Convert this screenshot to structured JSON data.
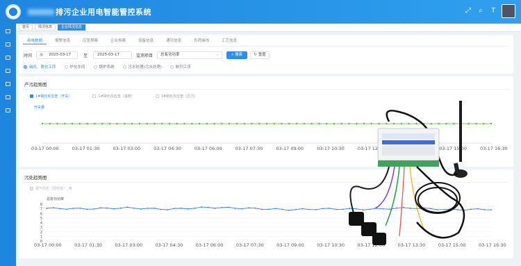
{
  "app": {
    "title": "排污企业用电智能管控系统"
  },
  "page_tabs": [
    {
      "label": "首页"
    },
    {
      "label": "情况信息"
    },
    {
      "label": "企业情况信息"
    }
  ],
  "subtabs": [
    {
      "label": "用电数据"
    },
    {
      "label": "报警信息"
    },
    {
      "label": "应急预案"
    },
    {
      "label": "企业档案"
    },
    {
      "label": "设备信息"
    },
    {
      "label": "通讯信息"
    },
    {
      "label": "负荷曲线"
    },
    {
      "label": "工艺信息"
    }
  ],
  "filter": {
    "time_label": "时间",
    "start_date": "2025-03-17",
    "range_sep": "至",
    "end_date": "2025-03-17",
    "monitor_label": "监测项目",
    "monitor_value": "总有功功率",
    "search_label": "搜索",
    "reset_label": "重置"
  },
  "radios": [
    {
      "label": "硝化、脱化工序"
    },
    {
      "label": "炉化车间"
    },
    {
      "label": "锅炉系统"
    },
    {
      "label": "污水处理(污水处理)"
    },
    {
      "label": "制剂工序"
    }
  ],
  "chart1": {
    "title": "产污趋势图",
    "legend": [
      {
        "label": "1#硝化反应釜（开关）"
      },
      {
        "label": "1#硝化反应釜（温度）"
      },
      {
        "label": "1#硝化反应釜（压力）"
      }
    ]
  },
  "chart2": {
    "title": "污处趋势图",
    "legend": [
      {
        "label": "尾气风机（回性能）_用"
      }
    ]
  },
  "colors": {
    "accent": "#2d8cf0",
    "topbar": "#1f86e0",
    "series1": "#52c41a",
    "series2": "#3b7dd8"
  },
  "chart_data": [
    {
      "type": "line",
      "ylabel": "开关量",
      "x": [
        "03-17 00:00",
        "03-17 01:30",
        "03-17 03:00",
        "03-17 04:30",
        "03-17 06:00",
        "03-17 07:30",
        "03-17 09:00",
        "03-17 10:30",
        "03-17 12:00",
        "03-17 13:30",
        "03-17 15:00",
        "03-17 16:30"
      ],
      "series": [
        {
          "name": "1#硝化反应釜（开关）",
          "values": [
            1,
            1,
            1,
            1,
            1,
            1,
            1,
            1,
            1,
            1,
            1,
            1
          ]
        }
      ],
      "ylim": [
        0,
        1
      ]
    },
    {
      "type": "line",
      "ylabel": "总有功功率",
      "x": [
        "03-17 00:00",
        "03-17 01:30",
        "03-17 03:00",
        "03-17 04:30",
        "03-17 06:00",
        "03-17 07:30",
        "03-17 09:00",
        "03-17 10:30",
        "03-17 12:00",
        "03-17 13:30",
        "03-17 15:00",
        "03-17 16:30"
      ],
      "yticks": [
        0,
        1,
        2,
        3,
        4,
        5,
        6,
        7,
        8
      ],
      "ylim": [
        0,
        8
      ],
      "series": [
        {
          "name": "尾气风机（回性能）_用",
          "values": [
            7.1,
            7.0,
            7.2,
            6.9,
            7.3,
            7.1,
            6.8,
            7.0,
            6.9,
            7.2,
            6.8,
            6.9
          ]
        }
      ]
    }
  ]
}
